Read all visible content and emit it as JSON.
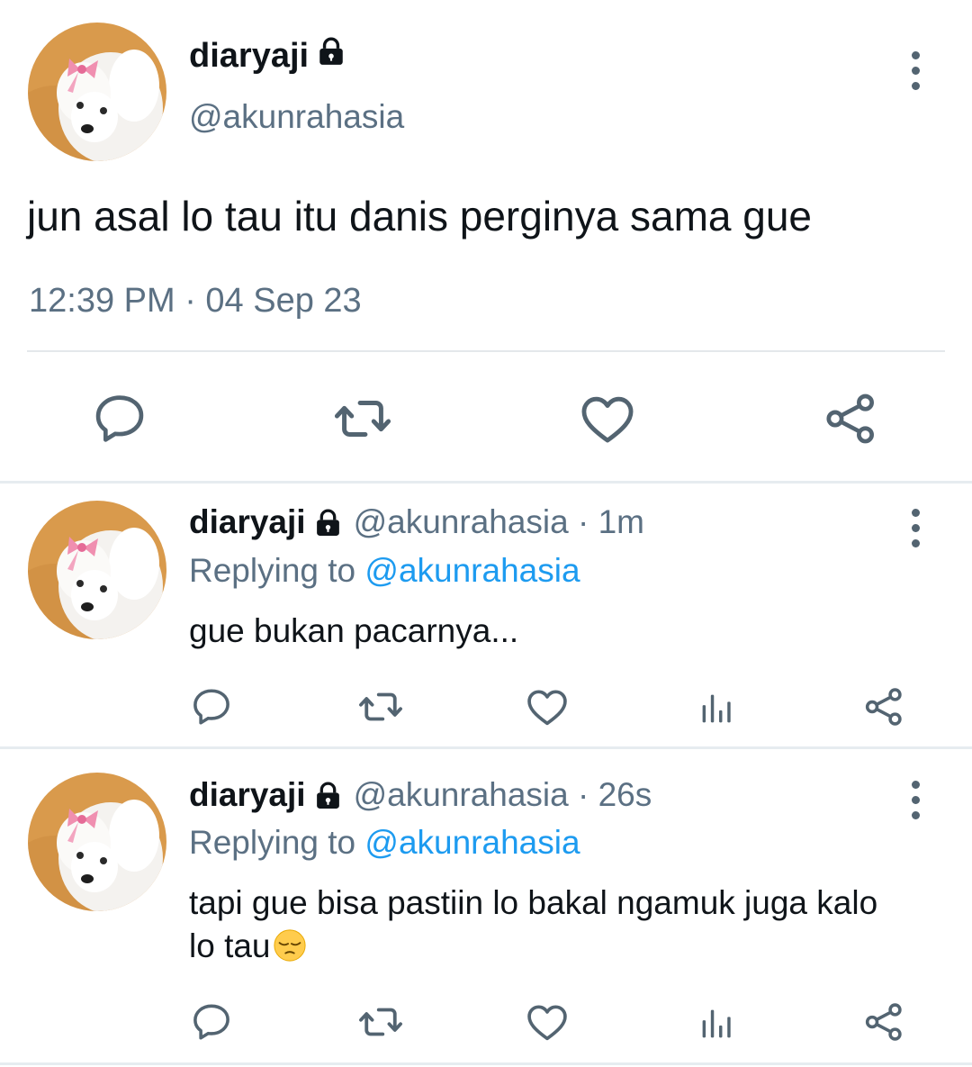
{
  "main_tweet": {
    "display_name": "diaryaji",
    "handle": "@akunrahasia",
    "text": "jun asal lo tau itu danis perginya sama gue",
    "timestamp": "12:39 PM · 04 Sep 23",
    "locked_icon": "lock-icon",
    "actions": [
      "reply-icon",
      "retweet-icon",
      "like-icon",
      "share-icon"
    ]
  },
  "replies": [
    {
      "display_name": "diaryaji",
      "handle_time": "@akunrahasia · 1m",
      "replying_prefix": "Replying to ",
      "replying_mention": "@akunrahasia",
      "text": "gue bukan pacarnya...",
      "actions": [
        "reply-icon",
        "retweet-icon",
        "like-icon",
        "analytics-icon",
        "share-icon"
      ]
    },
    {
      "display_name": "diaryaji",
      "handle_time": "@akunrahasia · 26s",
      "replying_prefix": "Replying to ",
      "replying_mention": "@akunrahasia",
      "text": "tapi gue bisa pastiin lo bakal ngamuk juga kalo lo tau",
      "emoji": "pensive-face",
      "actions": [
        "reply-icon",
        "retweet-icon",
        "like-icon",
        "analytics-icon",
        "share-icon"
      ]
    }
  ],
  "colors": {
    "text": "#0f1419",
    "secondary": "#5b7083",
    "link": "#1d9bf0",
    "divider": "#e6ecf0",
    "avatar_bg": "#d99a4c"
  }
}
